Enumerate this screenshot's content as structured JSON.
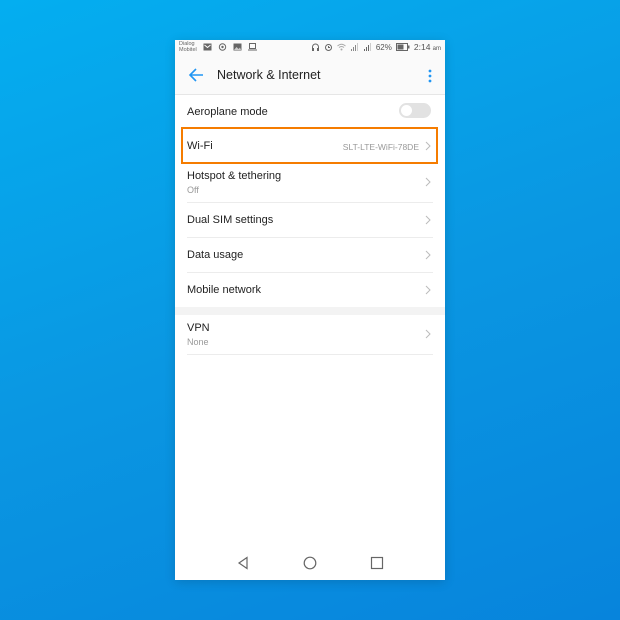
{
  "status_bar": {
    "carrier_line1": "Dialog",
    "carrier_line2": "Mobitel",
    "left_icons": [
      "gmail-icon",
      "whatsapp-icon",
      "gallery-icon",
      "laptop-icon"
    ],
    "right_icons": [
      "headset-icon",
      "alarm-icon",
      "wifi-icon",
      "signal-sim1-icon",
      "signal-sim2-icon"
    ],
    "battery": "62%",
    "time": "2:14",
    "ampm": "am"
  },
  "app_bar": {
    "back_icon": "arrow-left-icon",
    "title": "Network & Internet",
    "more_icon": "more-vert-icon"
  },
  "settings": {
    "aeroplane": {
      "label": "Aeroplane mode",
      "toggle_on": false
    },
    "wifi": {
      "label": "Wi-Fi",
      "value": "SLT-LTE-WiFi-78DE"
    },
    "hotspot": {
      "label": "Hotspot & tethering",
      "sub": "Off"
    },
    "dual_sim": {
      "label": "Dual SIM settings"
    },
    "data_usage": {
      "label": "Data usage"
    },
    "mobile_network": {
      "label": "Mobile network"
    },
    "vpn": {
      "label": "VPN",
      "sub": "None"
    }
  },
  "nav_bar": {
    "back": "nav-back-icon",
    "home": "nav-home-icon",
    "recents": "nav-recents-icon"
  },
  "colors": {
    "accent": "#2196f3",
    "highlight": "#f57c00",
    "background": "#0a97e2"
  }
}
